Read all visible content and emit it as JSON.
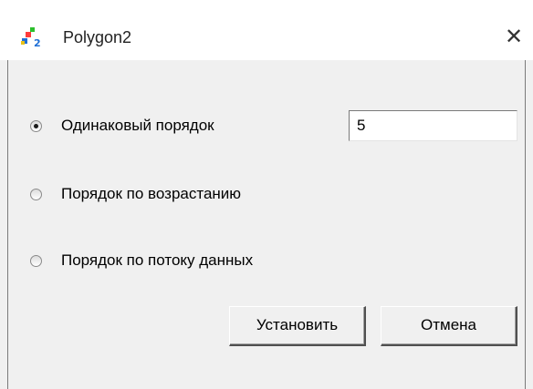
{
  "window": {
    "title": "Polygon2",
    "close_glyph": "✕",
    "app_icon": "polygon-app-icon"
  },
  "options": [
    {
      "label": "Одинаковый порядок",
      "checked": true
    },
    {
      "label": "Порядок по возрастанию",
      "checked": false
    },
    {
      "label": "Порядок по потоку данных",
      "checked": false
    }
  ],
  "order_input": {
    "value": "5"
  },
  "buttons": {
    "ok_label": "Установить",
    "cancel_label": "Отмена"
  }
}
